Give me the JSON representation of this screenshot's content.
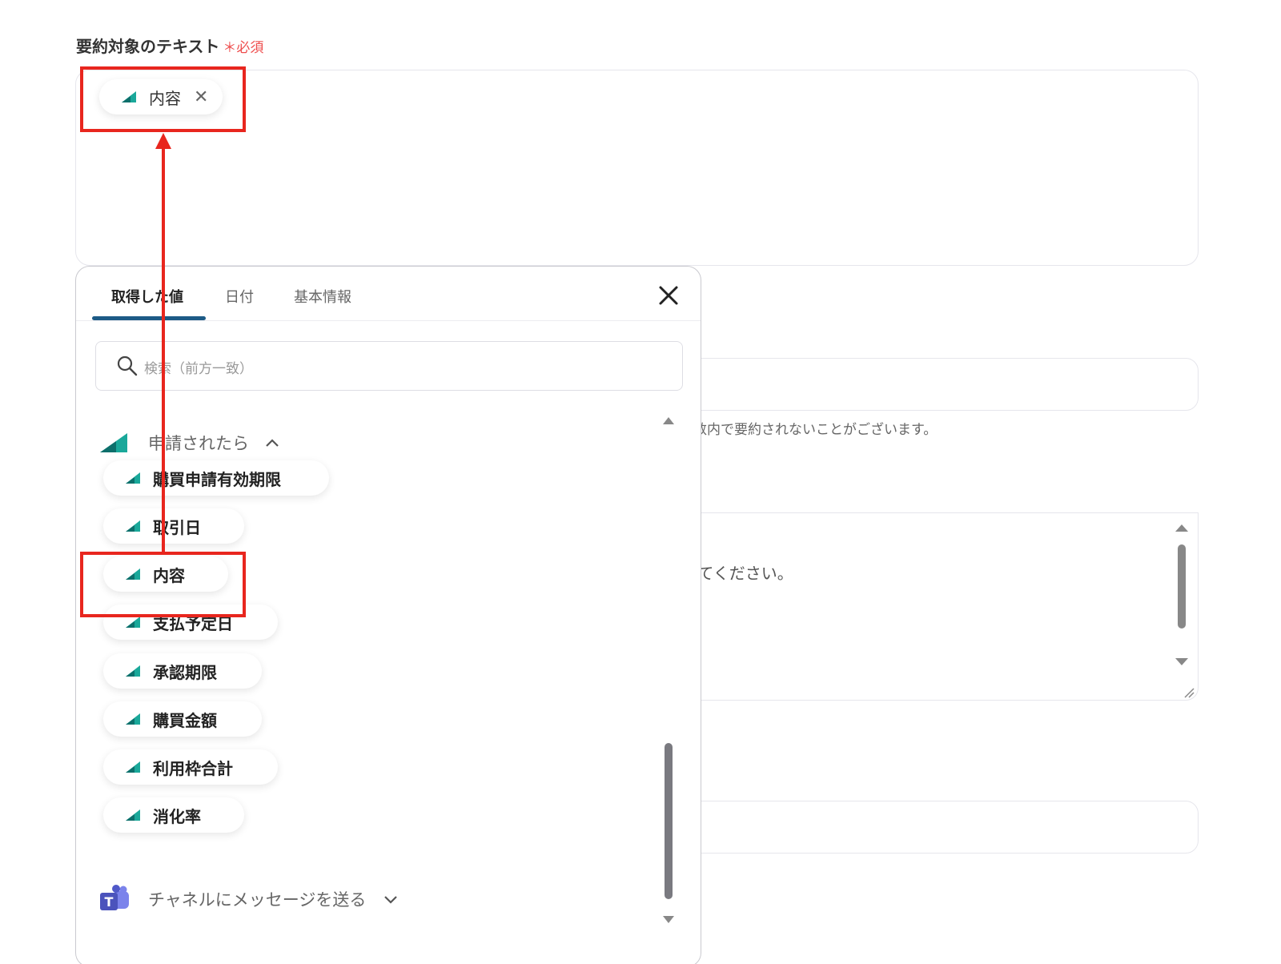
{
  "field_label": "要約対象のテキスト",
  "required_mark": "＊必須",
  "selected_chip": {
    "label": "内容",
    "remove_glyph": "✕"
  },
  "background": {
    "hint_text": "数内で要約されないことがございます。",
    "textarea_text": "してください。"
  },
  "popup": {
    "tabs": [
      "取得した値",
      "日付",
      "基本情報"
    ],
    "active_tab": "取得した値",
    "search_placeholder": "検索（前方一致）",
    "group": {
      "title": "申請されたら",
      "items": [
        "購買申請有効期限",
        "取引日",
        "内容",
        "支払予定日",
        "承認期限",
        "購買金額",
        "利用枠合計",
        "消化率"
      ]
    },
    "group2_title": "チャネルにメッセージを送る"
  },
  "colors": {
    "accent": "#1d5b86",
    "highlight": "#e8261e",
    "teal": "#1aa89a",
    "required": "#ee4d4d"
  },
  "icons": {
    "app": "yoom-app-icon",
    "teams": "teams-icon"
  }
}
